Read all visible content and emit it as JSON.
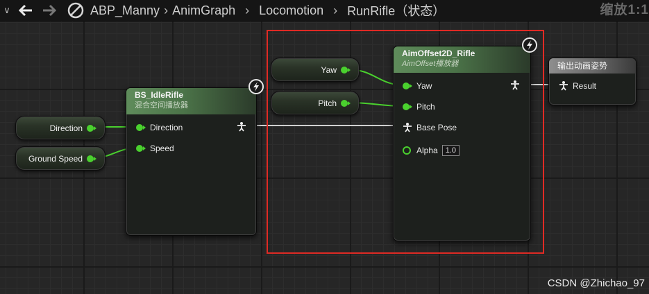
{
  "toolbar": {
    "back_icon": "arrow-left-icon",
    "forward_icon": "arrow-right-icon",
    "blueprint_icon": "blueprint-slash-icon",
    "breadcrumb": [
      "ABP_Manny",
      "AnimGraph",
      "Locomotion",
      "RunRifle（状态）"
    ],
    "zoom_label": "缩放1:1"
  },
  "variables": {
    "direction": "Direction",
    "ground_speed": "Ground Speed",
    "yaw": "Yaw",
    "pitch": "Pitch"
  },
  "nodes": {
    "blendspace": {
      "title": "BS_IdleRifle",
      "subtitle": "混合空间播放器",
      "inputs": [
        "Direction",
        "Speed"
      ]
    },
    "aimoffset": {
      "title": "AimOffset2D_Rifle",
      "subtitle": "AimOffset播放器",
      "inputs": [
        "Yaw",
        "Pitch",
        "Base Pose",
        "Alpha"
      ],
      "alpha_value": "1.0"
    },
    "output": {
      "title": "输出动画姿势",
      "input": "Result"
    }
  },
  "colors": {
    "float_pin": "#4ad12e",
    "highlight": "#e02a24",
    "exec_wire": "#d0d0d0"
  },
  "watermark": "CSDN @Zhichao_97"
}
